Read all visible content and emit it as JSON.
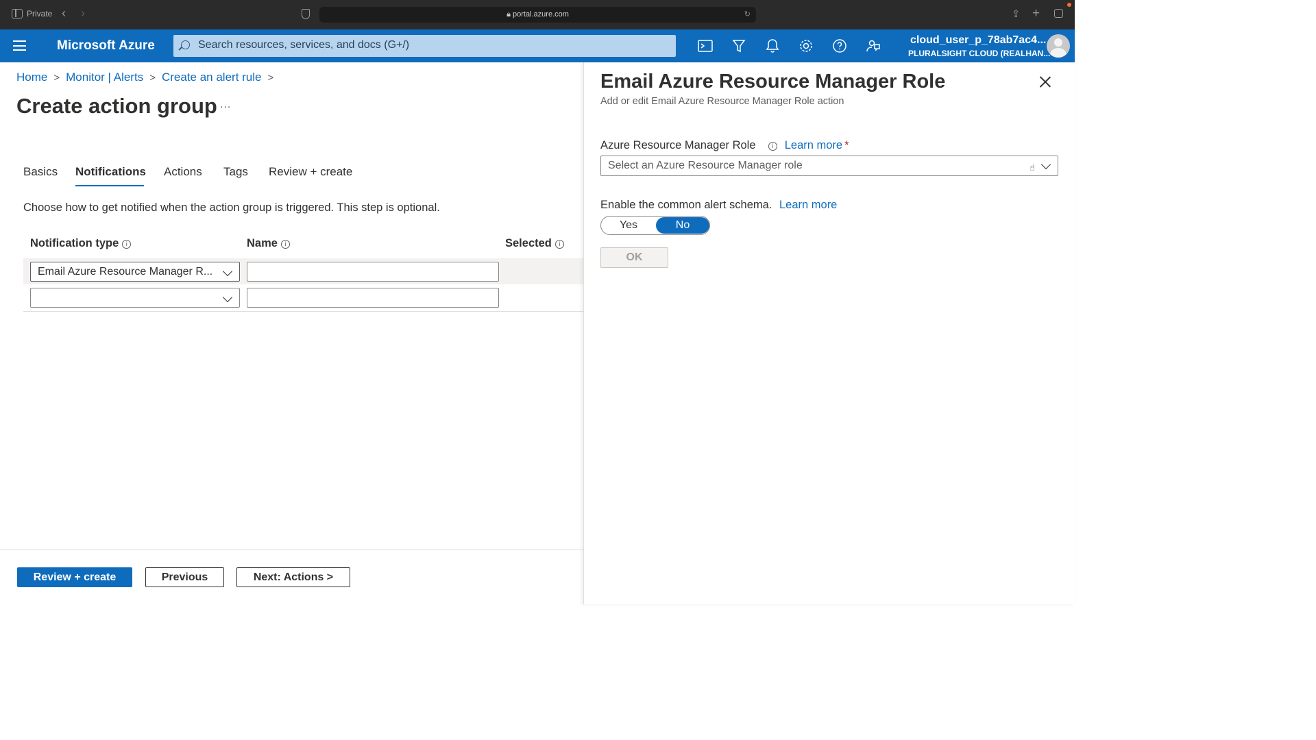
{
  "browser": {
    "private_label": "Private",
    "url": "portal.azure.com"
  },
  "topbar": {
    "brand": "Microsoft Azure",
    "search_placeholder": "Search resources, services, and docs (G+/)",
    "account_name": "cloud_user_p_78ab7ac4...",
    "account_directory": "PLURALSIGHT CLOUD (REALHAN...",
    "icons": [
      "cloud-shell-icon",
      "directory-filter-icon",
      "notifications-icon",
      "settings-icon",
      "help-icon",
      "feedback-icon"
    ]
  },
  "breadcrumb": {
    "items": [
      "Home",
      "Monitor | Alerts",
      "Create an alert rule"
    ]
  },
  "page": {
    "title": "Create action group",
    "more": "...",
    "description": "Choose how to get notified when the action group is triggered. This step is optional."
  },
  "tabs": [
    {
      "label": "Basics"
    },
    {
      "label": "Notifications",
      "active": true
    },
    {
      "label": "Actions"
    },
    {
      "label": "Tags"
    },
    {
      "label": "Review + create"
    }
  ],
  "table": {
    "columns": [
      "Notification type",
      "Name",
      "Selected"
    ],
    "rows": [
      {
        "type": "Email Azure Resource Manager R...",
        "name": ""
      },
      {
        "type": "",
        "name": ""
      }
    ]
  },
  "footer": {
    "review_create": "Review + create",
    "previous": "Previous",
    "next": "Next: Actions >"
  },
  "panel": {
    "title": "Email Azure Resource Manager Role",
    "subtitle": "Add or edit Email Azure Resource Manager Role action",
    "role_label": "Azure Resource Manager Role",
    "learn_more": "Learn more",
    "required_mark": "*",
    "role_placeholder": "Select an Azure Resource Manager role",
    "schema_label": "Enable the common alert schema.",
    "schema_learn_more": "Learn more",
    "toggle_yes": "Yes",
    "toggle_no": "No",
    "toggle_value": "No",
    "ok": "OK"
  },
  "colors": {
    "accent": "#0f6cbd",
    "topbar": "#0f6cbd"
  }
}
